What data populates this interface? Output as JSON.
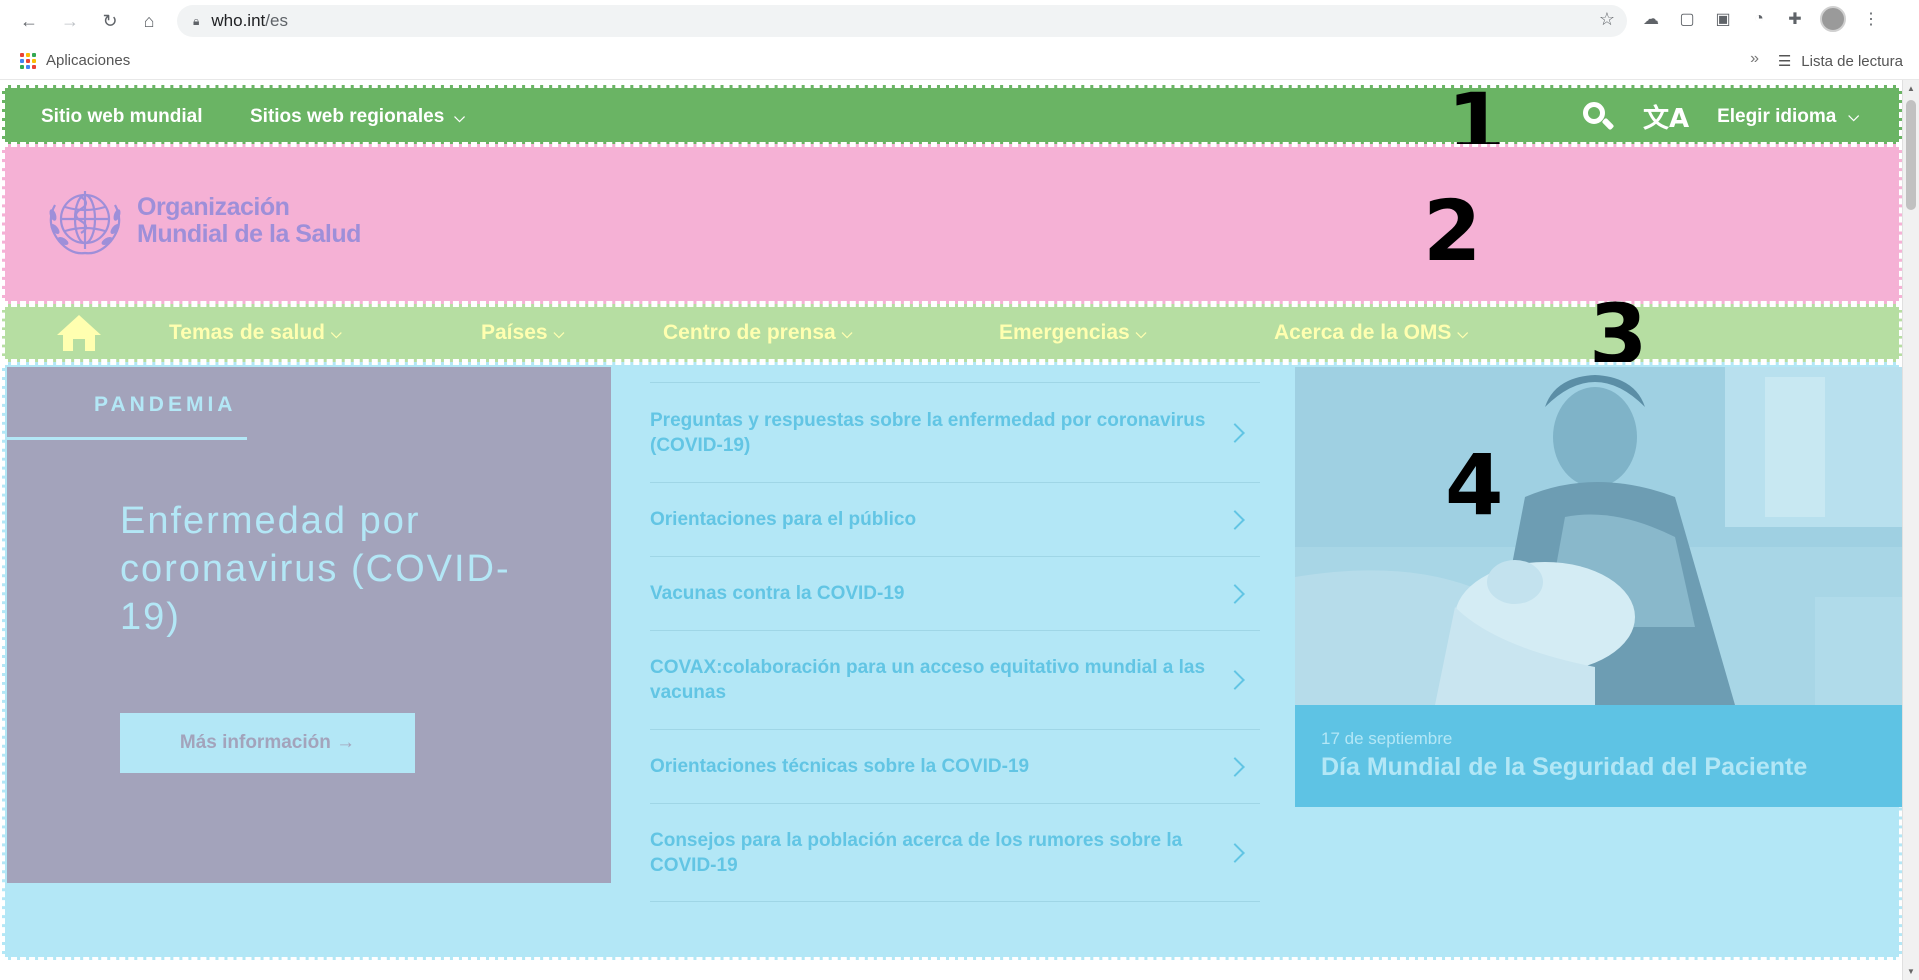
{
  "browser": {
    "url_host": "who.int",
    "url_path": "/es",
    "apps_label": "Aplicaciones",
    "reading_list_label": "Lista de lectura",
    "more_bookmarks": "»"
  },
  "top_bar": {
    "global_site": "Sitio web mundial",
    "regional_sites": "Sitios web regionales",
    "language": "Elegir idioma"
  },
  "logo": {
    "line1": "Organización",
    "line2": "Mundial de la Salud"
  },
  "nav": {
    "items": [
      {
        "label": "Temas de salud"
      },
      {
        "label": "Países"
      },
      {
        "label": "Centro de prensa"
      },
      {
        "label": "Emergencias"
      },
      {
        "label": "Acerca de la OMS"
      }
    ]
  },
  "pandemic": {
    "tab": "PANDEMIA",
    "title": "Enfermedad por coronavirus (COVID-19)",
    "button": "Más información →"
  },
  "links": [
    {
      "text": "Preguntas y respuestas sobre la enfermedad por coronavirus (COVID-19)"
    },
    {
      "text": "Orientaciones para el público"
    },
    {
      "text": "Vacunas contra la COVID-19"
    },
    {
      "text": "COVAX:colaboración para un acceso equitativo mundial a las vacunas"
    },
    {
      "text": "Orientaciones técnicas sobre la COVID-19"
    },
    {
      "text": "Consejos para la población acerca de los rumores sobre la COVID-19"
    }
  ],
  "news": {
    "date": "17 de septiembre",
    "title": "Día Mundial de la Seguridad del Paciente"
  },
  "region_labels": [
    "1",
    "2",
    "3",
    "4"
  ],
  "colors": {
    "region1": "#6ab464",
    "region2": "#f5b1d5",
    "region3": "#b6dea2",
    "region4": "#b3e7f6",
    "pandemic_panel": "#a3a3bb"
  }
}
